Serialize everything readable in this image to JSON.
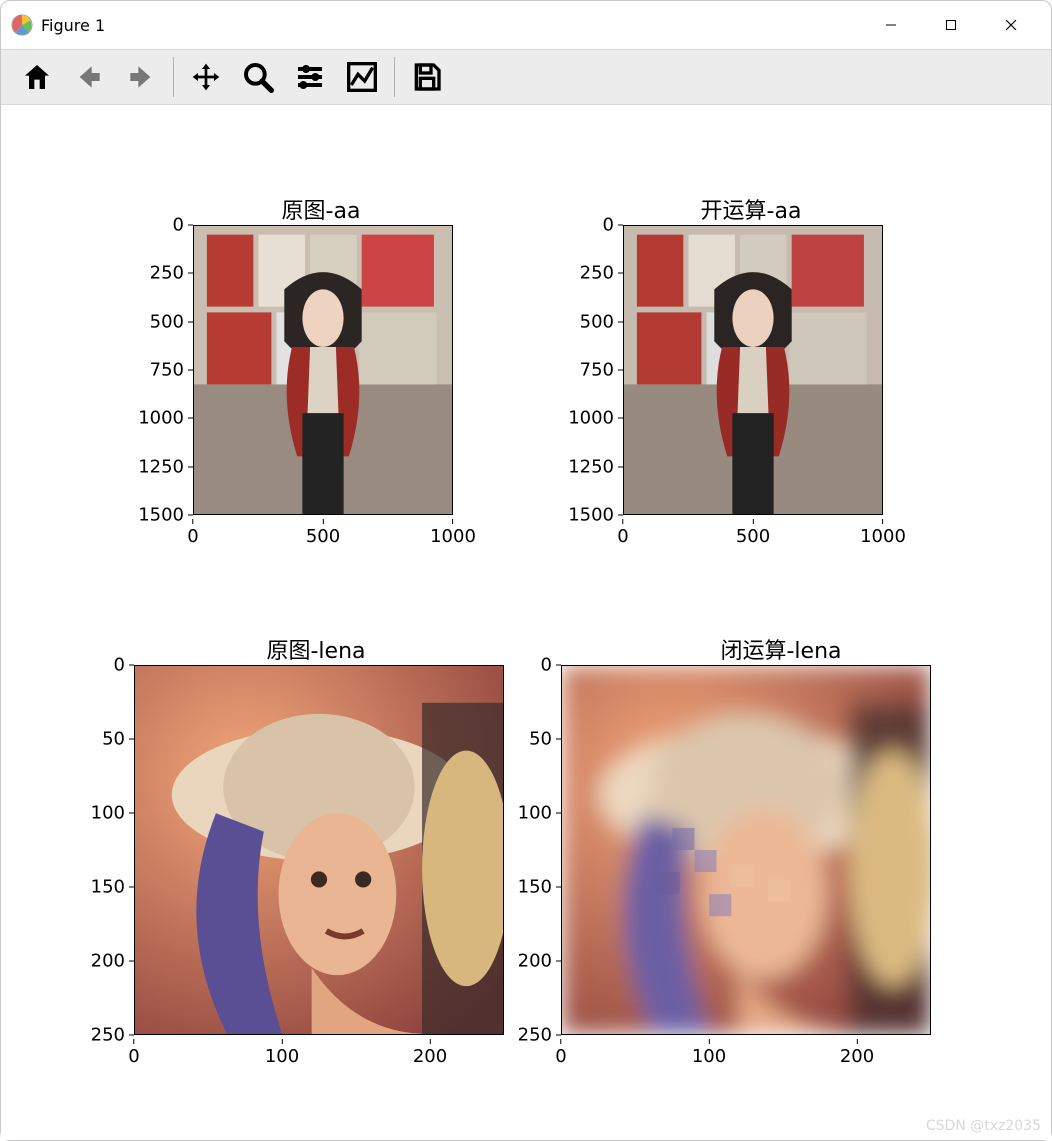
{
  "window": {
    "title": "Figure 1"
  },
  "toolbar": {
    "home": "home-icon",
    "back": "back-icon",
    "forward": "forward-icon",
    "pan": "pan-icon",
    "zoom": "zoom-icon",
    "configure": "configure-icon",
    "axes": "axes-icon",
    "save": "save-icon"
  },
  "watermark": "CSDN @txz2035",
  "chart_data": [
    {
      "type": "image",
      "title": "原图-aa",
      "description": "Original RGB image 'aa' (stylized woman in red jacket in front of poster wall)",
      "x_ticks": [
        0,
        500,
        1000
      ],
      "y_ticks": [
        0,
        250,
        500,
        750,
        1000,
        1250,
        1500
      ],
      "xlim": [
        0,
        1000
      ],
      "ylim": [
        1500,
        0
      ],
      "image_shape": [
        1500,
        1000
      ]
    },
    {
      "type": "image",
      "title": "开运算-aa",
      "description": "Morphological opening applied to image 'aa' (slightly smoothed version of original)",
      "x_ticks": [
        0,
        500,
        1000
      ],
      "y_ticks": [
        0,
        250,
        500,
        750,
        1000,
        1250,
        1500
      ],
      "xlim": [
        0,
        1000
      ],
      "ylim": [
        1500,
        0
      ],
      "image_shape": [
        1500,
        1000
      ]
    },
    {
      "type": "image",
      "title": "原图-lena",
      "description": "Original Lena test image (woman with hat)",
      "x_ticks": [
        0,
        100,
        200
      ],
      "y_ticks": [
        0,
        50,
        100,
        150,
        200,
        250
      ],
      "xlim": [
        0,
        250
      ],
      "ylim": [
        250,
        0
      ],
      "image_shape": [
        250,
        250
      ]
    },
    {
      "type": "image",
      "title": "闭运算-lena",
      "description": "Morphological closing applied to Lena image (heavily blurred / blocky version)",
      "x_ticks": [
        0,
        100,
        200
      ],
      "y_ticks": [
        0,
        50,
        100,
        150,
        200,
        250
      ],
      "xlim": [
        0,
        250
      ],
      "ylim": [
        250,
        0
      ],
      "image_shape": [
        250,
        250
      ]
    }
  ]
}
